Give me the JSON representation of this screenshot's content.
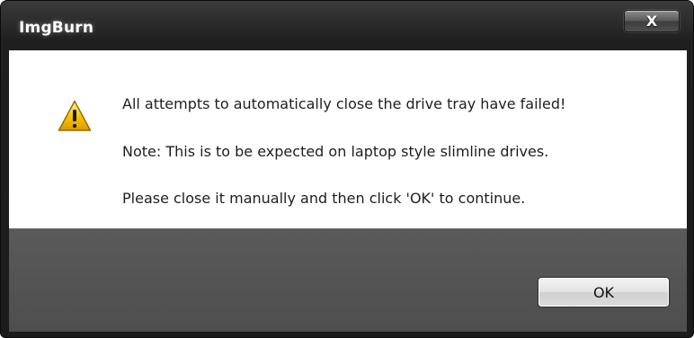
{
  "window": {
    "title": "ImgBurn",
    "close_label": "X"
  },
  "dialog": {
    "icon": "warning-icon",
    "messages": [
      "All attempts to automatically close the drive tray have failed!",
      "Note: This is to be expected on laptop style slimline drives.",
      "Please close it manually and then click 'OK' to continue."
    ]
  },
  "buttons": {
    "ok_label": "OK"
  },
  "colors": {
    "frame": "#1f1f1f",
    "footer": "#555555",
    "warning_fill": "#f5c400",
    "text": "#1e1e1e"
  }
}
